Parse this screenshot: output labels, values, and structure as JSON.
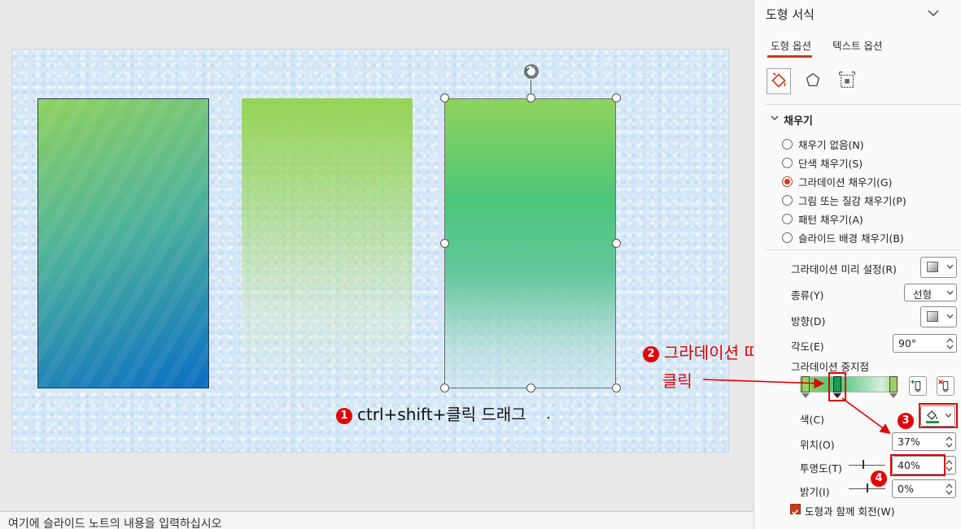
{
  "slide": {
    "notes_placeholder": "여기에 슬라이드 노트의 내용을 입력하십시오"
  },
  "annotations": {
    "step1_num": "1",
    "step1_text": "ctrl+shift+클릭 드래그",
    "step2_num": "2",
    "step2_text_line1": "그라데이션 띠",
    "step2_text_line2": "클릭",
    "step3_num": "3",
    "step4_num": "4",
    "color_red": "#e10000"
  },
  "pane": {
    "title": "도형 서식",
    "tabs": [
      {
        "label": "도형 옵션",
        "active": true
      },
      {
        "label": "텍스트 옵션",
        "active": false
      }
    ],
    "section_title": "채우기",
    "fill_options": [
      {
        "label": "채우기 없음(N)",
        "selected": false
      },
      {
        "label": "단색 채우기(S)",
        "selected": false
      },
      {
        "label": "그라데이션 채우기(G)",
        "selected": true
      },
      {
        "label": "그림 또는 질감 채우기(P)",
        "selected": false
      },
      {
        "label": "패턴 채우기(A)",
        "selected": false
      },
      {
        "label": "슬라이드 배경 채우기(B)",
        "selected": false
      }
    ],
    "props": {
      "preset_label": "그라데이션 미리 설정(R)",
      "type_label": "종류(Y)",
      "type_value": "선형",
      "direction_label": "방향(D)",
      "angle_label": "각도(E)",
      "angle_value": "90°",
      "stops_label": "그라데이션 중지점",
      "color_label": "색(C)",
      "position_label": "위치(O)",
      "position_value": "37%",
      "transparency_label": "투명도(T)",
      "transparency_value": "40%",
      "brightness_label": "밝기(I)",
      "brightness_value": "0%",
      "rotate_label": "도형과 함께 회전(W)"
    },
    "accent": "#c43e1c"
  }
}
